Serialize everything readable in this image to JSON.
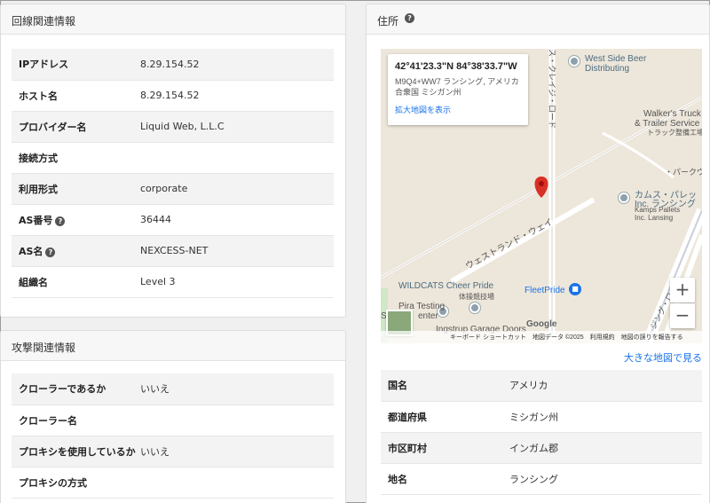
{
  "network": {
    "title": "回線関連情報",
    "rows": [
      {
        "key": "IPアドレス",
        "value": "8.29.154.52",
        "help": false
      },
      {
        "key": "ホスト名",
        "value": "8.29.154.52",
        "help": false
      },
      {
        "key": "プロバイダー名",
        "value": "Liquid Web, L.L.C",
        "help": false
      },
      {
        "key": "接続方式",
        "value": "",
        "help": false
      },
      {
        "key": "利用形式",
        "value": "corporate",
        "help": false
      },
      {
        "key": "AS番号",
        "value": "36444",
        "help": true
      },
      {
        "key": "AS名",
        "value": "NEXCESS-NET",
        "help": true
      },
      {
        "key": "組織名",
        "value": "Level 3",
        "help": false
      }
    ]
  },
  "attack": {
    "title": "攻撃関連情報",
    "rows": [
      {
        "key": "クローラーであるか",
        "value": "いいえ"
      },
      {
        "key": "クローラー名",
        "value": ""
      },
      {
        "key": "プロキシを使用しているか",
        "value": "いいえ"
      },
      {
        "key": "プロキシの方式",
        "value": ""
      }
    ]
  },
  "address": {
    "title": "住所",
    "help_glyph": "?",
    "map": {
      "coord": "42°41'23.3\"N 84°38'33.7\"W",
      "plus_code": "M9Q4+WW7 ランシング, アメリカ合衆国 ミシガン州",
      "enlarge_link": "拡大地図を表示",
      "labels": {
        "west_side_beer": "West Side Beer",
        "distributing": "Distributing",
        "walkers_truck": "Walker's Truck",
        "trailer_service": "& Trailer Service",
        "truck_shop": "トラック整備工場",
        "kamus_pallet": "カムス・パレッ",
        "inc_lansing_jp": "Inc. ランシング",
        "kamps_pallets": "Kamps Pallets",
        "inc_lansing": "Inc. Lansing",
        "westland_way": "ウェストランド・ウェイ",
        "wildcats": "WILDCATS Cheer Pride",
        "gym_class": "体操競技場",
        "fleetpride": "FleetPride",
        "pira_testing": "Pira Testing",
        "se_center": "Se",
        "enter": "enter",
        "ingstrup": "Ingstrup Garage Doors",
        "park_road": "・パークウ",
        "crazy_road": "ス・クレイジ・ロード",
        "king_road": "ジング・ロード",
        "google": "Google"
      },
      "zoom_in": "+",
      "zoom_out": "−",
      "attribution": "キーボード ショートカット　地図データ ©2025　利用規約　地図の誤りを報告する"
    },
    "bigger_map_link": "大きな地図で見る",
    "rows": [
      {
        "key": "国名",
        "value": "アメリカ"
      },
      {
        "key": "都道府県",
        "value": "ミシガン州"
      },
      {
        "key": "市区町村",
        "value": "インガム郡"
      },
      {
        "key": "地名",
        "value": "ランシング"
      }
    ]
  }
}
